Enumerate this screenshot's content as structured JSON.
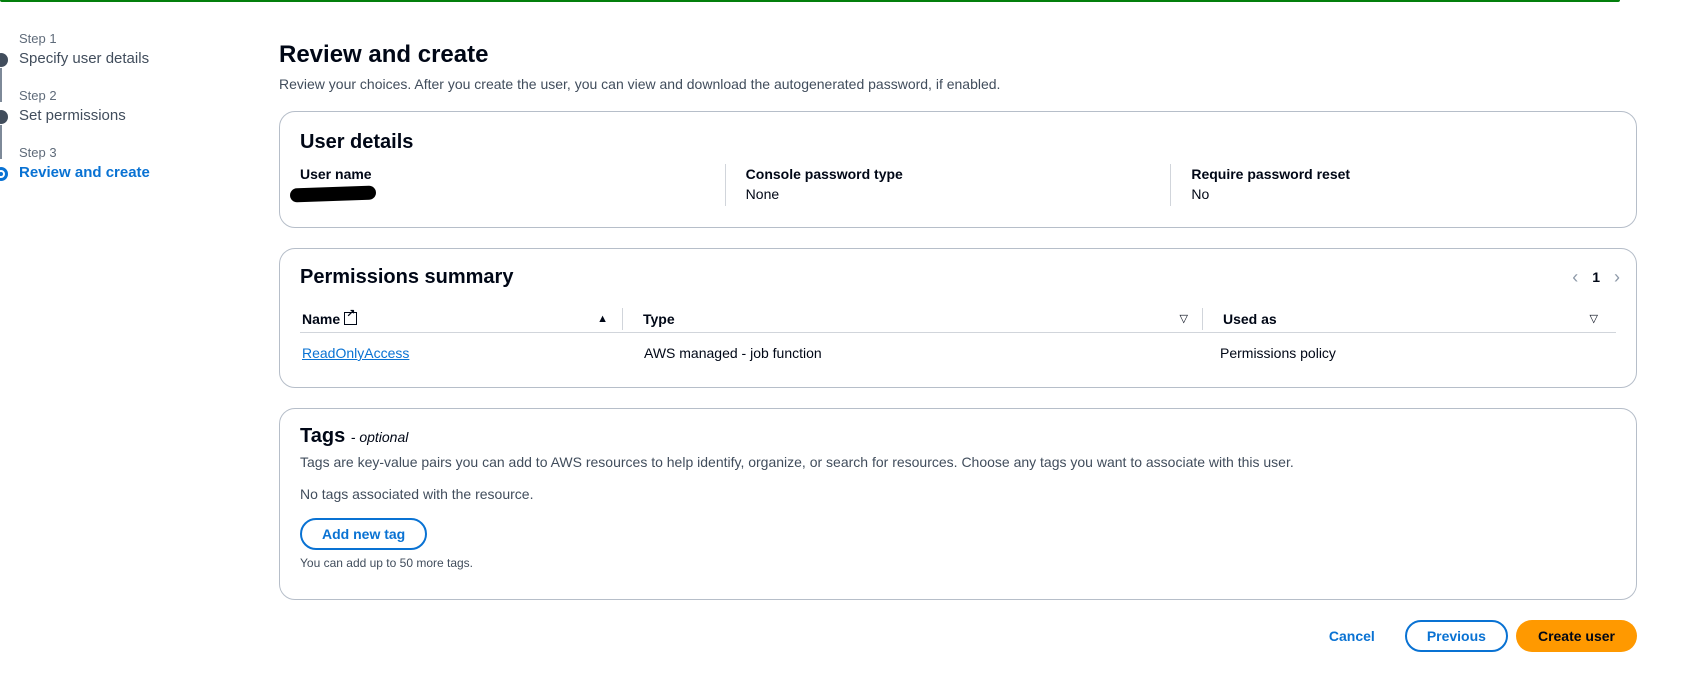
{
  "wizard": {
    "steps": [
      {
        "num": "Step 1",
        "title": "Specify user details"
      },
      {
        "num": "Step 2",
        "title": "Set permissions"
      },
      {
        "num": "Step 3",
        "title": "Review and create"
      }
    ],
    "active_step": 3
  },
  "page": {
    "title": "Review and create",
    "description": "Review your choices. After you create the user, you can view and download the autogenerated password, if enabled."
  },
  "user_details": {
    "title": "User details",
    "user_name_label": "User name",
    "user_name_value": "",
    "console_password_type_label": "Console password type",
    "console_password_type_value": "None",
    "require_password_reset_label": "Require password reset",
    "require_password_reset_value": "No"
  },
  "permissions": {
    "title": "Permissions summary",
    "page": "1",
    "columns": [
      "Name",
      "Type",
      "Used as"
    ],
    "rows": [
      {
        "name": "ReadOnlyAccess",
        "type": "AWS managed - job function",
        "used_as": "Permissions policy"
      }
    ]
  },
  "tags": {
    "title": "Tags",
    "optional": "- optional",
    "description": "Tags are key-value pairs you can add to AWS resources to help identify, organize, or search for resources. Choose any tags you want to associate with this user.",
    "empty": "No tags associated with the resource.",
    "add_button": "Add new tag",
    "limit": "You can add up to 50 more tags."
  },
  "footer": {
    "cancel": "Cancel",
    "previous": "Previous",
    "create": "Create user"
  },
  "colors": {
    "accent": "#0972d3",
    "primary_button": "#ff9900",
    "success_bar": "#037f0c"
  }
}
